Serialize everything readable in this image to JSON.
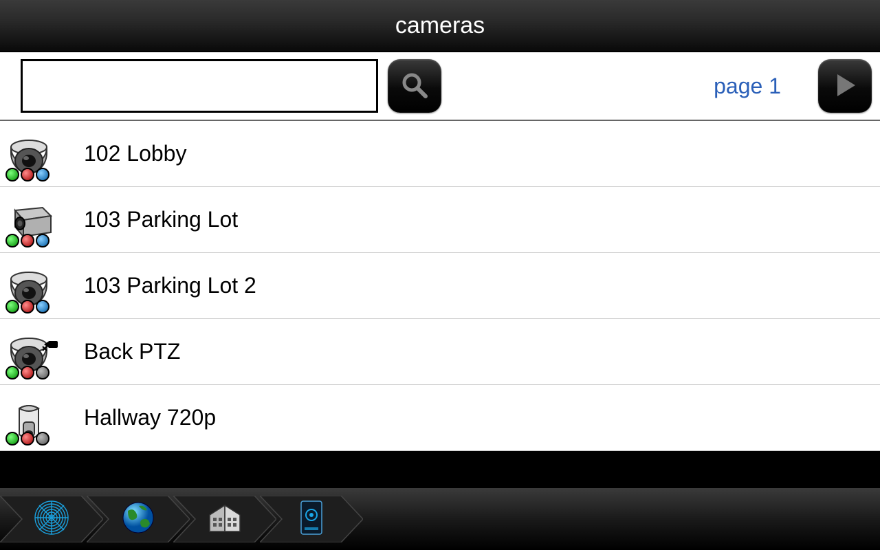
{
  "header": {
    "title": "cameras"
  },
  "search": {
    "value": "",
    "placeholder": ""
  },
  "page_label": "page 1",
  "cameras": [
    {
      "name": "102 Lobby",
      "type": "dome",
      "leds": [
        "g",
        "r",
        "b"
      ],
      "ptz": false
    },
    {
      "name": "103 Parking Lot",
      "type": "box",
      "leds": [
        "g",
        "r",
        "b"
      ],
      "ptz": false
    },
    {
      "name": "103 Parking Lot 2",
      "type": "dome",
      "leds": [
        "g",
        "r",
        "b"
      ],
      "ptz": false
    },
    {
      "name": "Back PTZ",
      "type": "dome",
      "leds": [
        "g",
        "r",
        "k"
      ],
      "ptz": true
    },
    {
      "name": "Hallway 720p",
      "type": "bullet",
      "leds": [
        "g",
        "r",
        "k"
      ],
      "ptz": false
    }
  ],
  "breadcrumbs": [
    {
      "id": "root",
      "icon": "fingerprint"
    },
    {
      "id": "sites",
      "icon": "globe"
    },
    {
      "id": "site",
      "icon": "building"
    },
    {
      "id": "server",
      "icon": "server"
    }
  ]
}
